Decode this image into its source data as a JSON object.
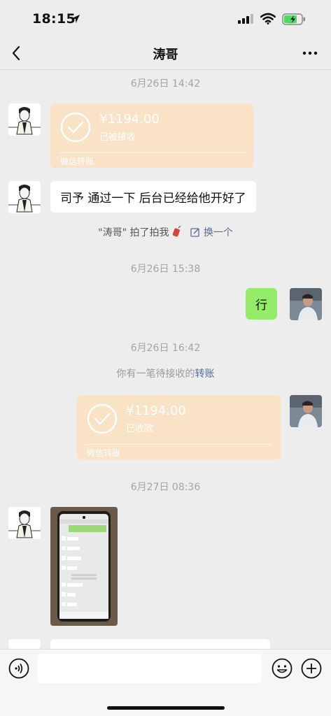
{
  "status": {
    "time": "18:15"
  },
  "header": {
    "title": "涛哥"
  },
  "messages": {
    "time1": "6月26日 14:42",
    "transfer1": {
      "amount": "¥1194.00",
      "state": "已被接收",
      "footer": "微信转账"
    },
    "text1": "司予 通过一下 后台已经给他开好了",
    "pat": {
      "name": "\"涛哥\"",
      "action": " 拍了拍我",
      "link": "换一个"
    },
    "time2": "6月26日 15:38",
    "text2": "行",
    "time3": "6月26日 16:42",
    "pending": {
      "prefix": "你有一笔待接收的",
      "link": "转账"
    },
    "transfer2": {
      "amount": "¥1194.00",
      "state": "已收款",
      "footer": "微信转账"
    },
    "time4": "6月27日 08:36"
  },
  "colors": {
    "transfer_bg": "#f9e2c5",
    "self_bubble": "#95ec69",
    "link": "#576b95"
  }
}
